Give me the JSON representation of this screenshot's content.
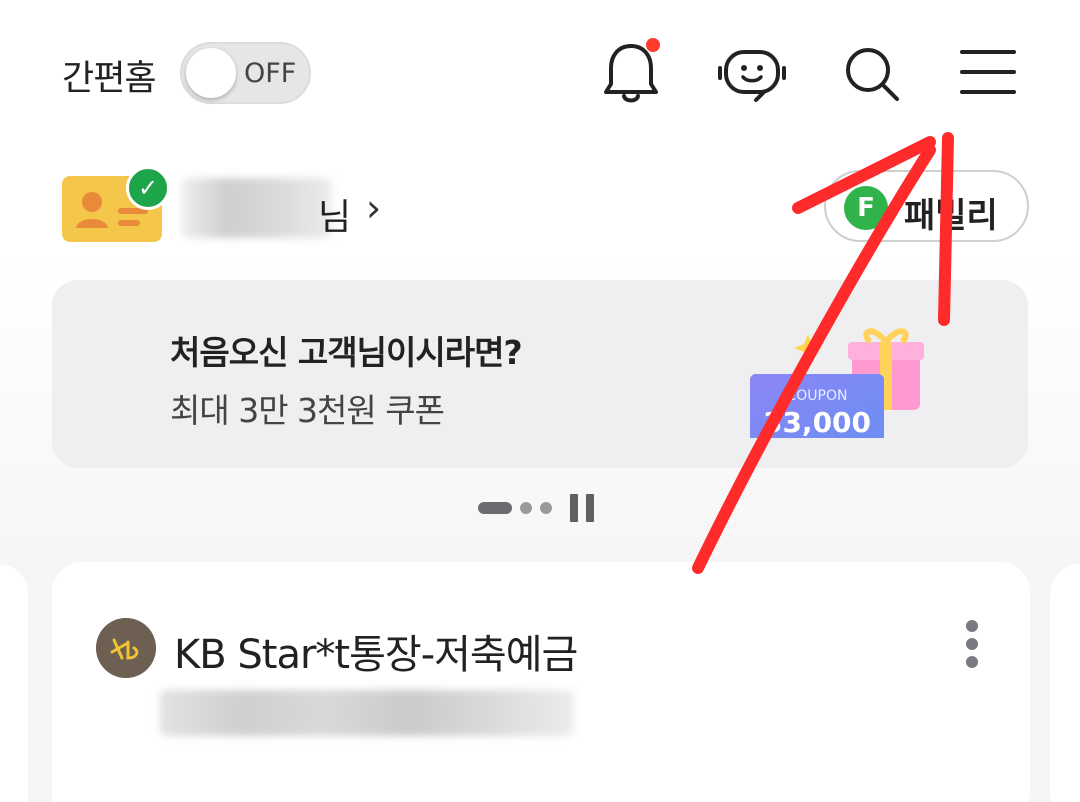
{
  "header": {
    "easy_home_label": "간편홈",
    "toggle_text": "OFF",
    "icons": [
      "bell-icon",
      "chatbot-icon",
      "search-icon",
      "menu-icon"
    ],
    "notification_dot_color": "#ff3b30"
  },
  "profile": {
    "name_suffix": "님",
    "chevron": "›",
    "verified_badge": "✓",
    "family_button": {
      "badge": "F",
      "label": "패밀리"
    }
  },
  "banner": {
    "title": "처음오신 고객님이시라면?",
    "subtitle": "최대 3만 3천원 쿠폰",
    "coupon_label": "COUPON",
    "coupon_amount": "33,000"
  },
  "pager": {
    "total": 3,
    "active_index": 0,
    "pause_icon": "pause-icon"
  },
  "account": {
    "name": "KB Star*t통장-저축예금",
    "logo": "KB",
    "more_icon": "more-vertical-icon"
  },
  "colors": {
    "accent_green": "#2fb34a",
    "annotation_red": "#ff2b2b"
  }
}
